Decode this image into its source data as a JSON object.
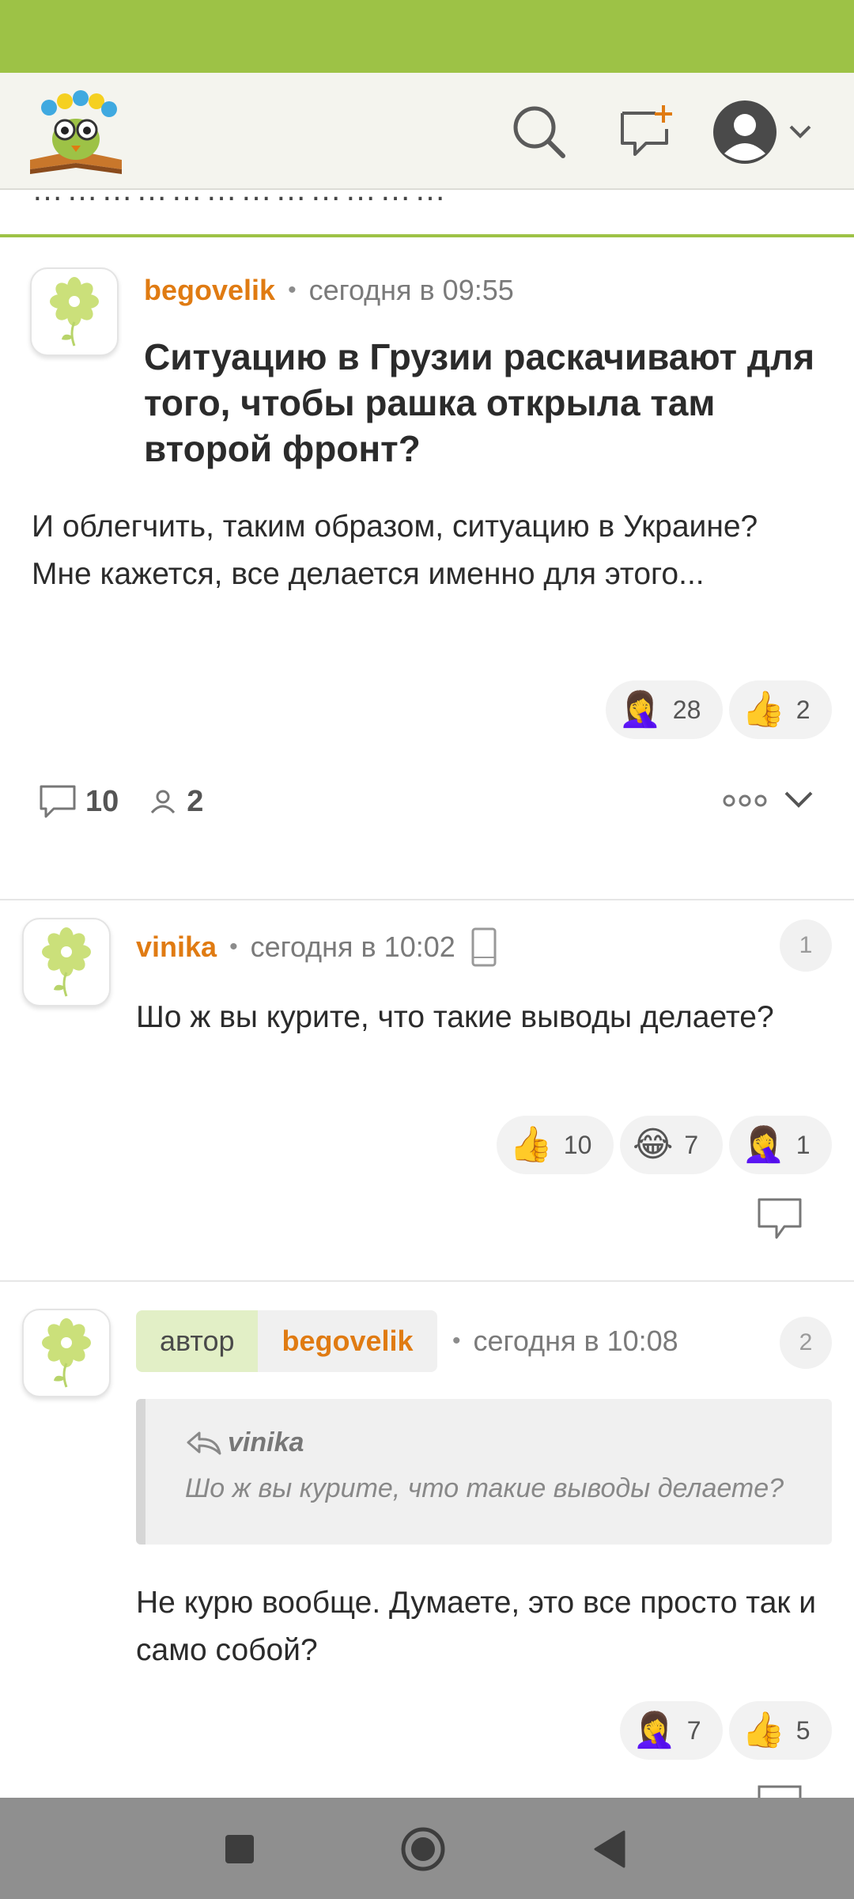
{
  "header": {
    "logo_icon": "owl-with-books-logo",
    "search_icon": "search-icon",
    "new_post_icon": "new-post-icon",
    "profile_icon": "user-avatar-icon"
  },
  "clipped_line": "………………………………",
  "post": {
    "author": "begovelik",
    "time": "сегодня в 09:55",
    "title": "Ситуацию в Грузии раскачивают для того, чтобы рашка открыла там второй фронт?",
    "body": "И облегчить, таким образом, ситуацию в Украине? Мне кажется, все делается именно для этого...",
    "reactions": [
      {
        "emoji": "🤦‍♀️",
        "count": "28"
      },
      {
        "emoji": "👍",
        "count": "2"
      }
    ],
    "comments_count": "10",
    "participants_count": "2"
  },
  "comments": [
    {
      "number": "1",
      "author": "vinika",
      "time": "сегодня в 10:02",
      "text": "Шо ж вы курите, что такие выводы делаете?",
      "reactions": [
        {
          "emoji": "👍",
          "count": "10"
        },
        {
          "emoji": "😂",
          "count": "7"
        },
        {
          "emoji": "🤦‍♀️",
          "count": "1"
        }
      ]
    },
    {
      "number": "2",
      "author_tag": "автор",
      "author": "begovelik",
      "time": "сегодня в 10:08",
      "quote": {
        "author": "vinika",
        "text": "Шо ж вы курите, что такие выводы делаете?"
      },
      "text": "Не курю вообще. Думаете, это все просто так и само собой?",
      "reactions": [
        {
          "emoji": "🤦‍♀️",
          "count": "7"
        },
        {
          "emoji": "👍",
          "count": "5"
        }
      ]
    }
  ],
  "colors": {
    "brand_green": "#9dc246",
    "author_orange": "#e07b12"
  }
}
